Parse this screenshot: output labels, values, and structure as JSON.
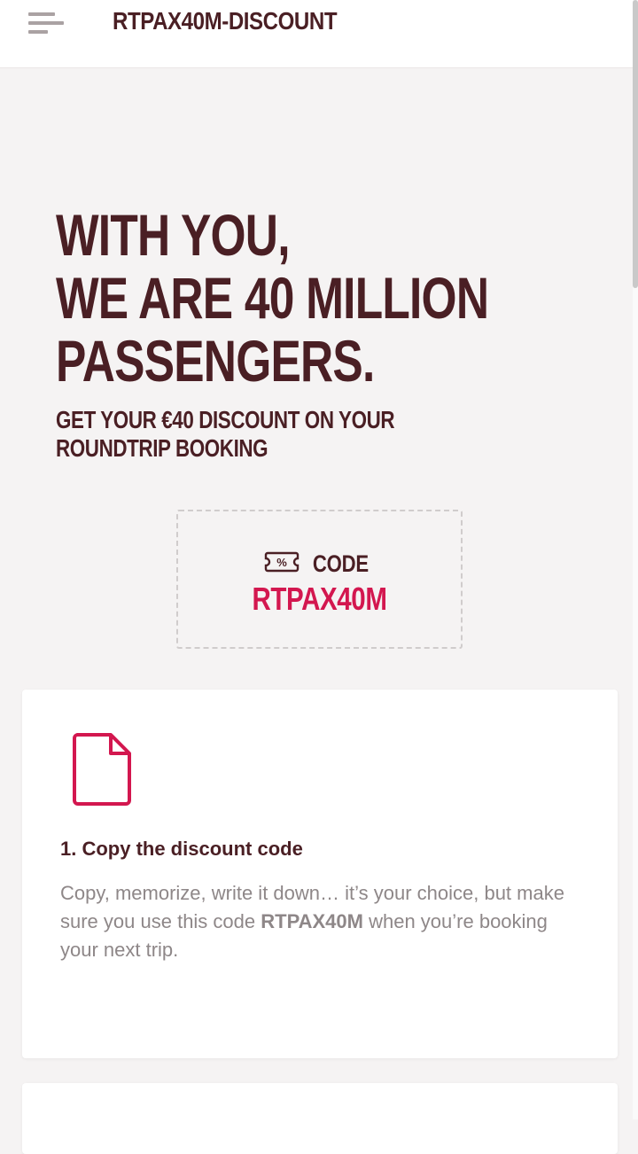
{
  "header": {
    "title": "RTPAX40M-DISCOUNT",
    "menu_icon": "hamburger-menu-icon"
  },
  "hero": {
    "line1": "WITH YOU,",
    "line2": "WE ARE 40 MILLION",
    "line3": "PASSENGERS.",
    "subtitle": "GET YOUR €40 DISCOUNT ON YOUR ROUNDTRIP BOOKING"
  },
  "code_box": {
    "icon": "coupon-percent-icon",
    "icon_glyph": "%",
    "label": "CODE",
    "value": "RTPAX40M"
  },
  "steps": [
    {
      "icon": "document-icon",
      "title": "1. Copy the discount code",
      "text_before": "Copy, memorize, write it down… it’s your choice, but make sure you use this code ",
      "text_code": "RTPAX40M",
      "text_after": " when you’re booking your next trip."
    }
  ],
  "colors": {
    "background": "#f5f3f3",
    "primary_text": "#4a1f24",
    "accent": "#d3174f",
    "muted_text": "#8e8788",
    "menu_icon": "#aaa2a3",
    "dashed_border": "#d0cccc"
  }
}
